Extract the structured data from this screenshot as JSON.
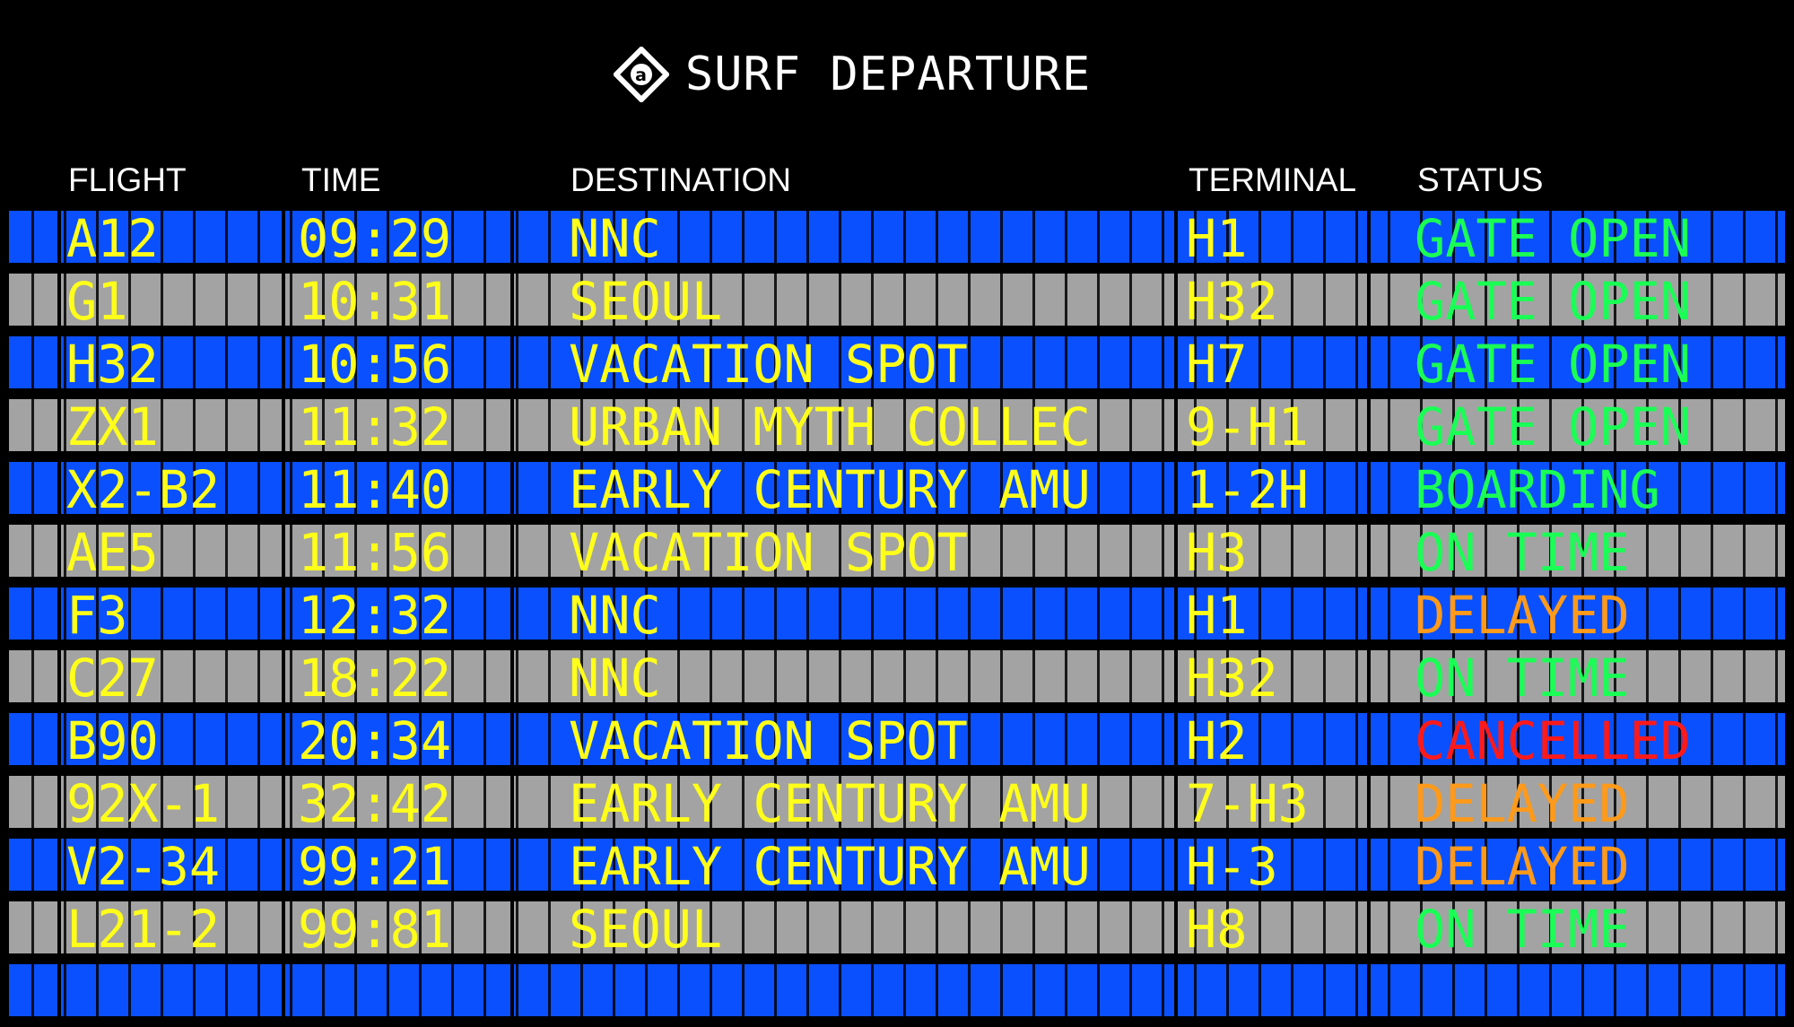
{
  "title": "SURF DEPARTURE",
  "logo_icon": "diamond-a-logo-icon",
  "headers": {
    "flight": "FLIGHT",
    "time": "TIME",
    "destination": "DESTINATION",
    "terminal": "TERMINAL",
    "status": "STATUS"
  },
  "colors": {
    "blue_row": "#0a50ff",
    "gray_row": "#a3a3a3",
    "text_yellow": "#ffff1a",
    "status_green": "#1aff55",
    "status_orange": "#ff9a1a",
    "status_red": "#ff1a1a"
  },
  "rows": [
    {
      "flight": "A12",
      "time": "09:29",
      "destination": "NNC",
      "terminal": "H1",
      "status": "GATE OPEN",
      "status_color": "#1aff55"
    },
    {
      "flight": "G1",
      "time": "10:31",
      "destination": "SEOUL",
      "terminal": "H32",
      "status": "GATE OPEN",
      "status_color": "#1aff55"
    },
    {
      "flight": "H32",
      "time": "10:56",
      "destination": "VACATION SPOT",
      "terminal": "H7",
      "status": "GATE OPEN",
      "status_color": "#1aff55"
    },
    {
      "flight": "ZX1",
      "time": "11:32",
      "destination": "URBAN MYTH COLLEC",
      "terminal": "9-H1",
      "status": "GATE OPEN",
      "status_color": "#1aff55"
    },
    {
      "flight": "X2-B2",
      "time": "11:40",
      "destination": "EARLY CENTURY AMU",
      "terminal": "1-2H",
      "status": "BOARDING",
      "status_color": "#1aff55"
    },
    {
      "flight": "AE5",
      "time": "11:56",
      "destination": "VACATION SPOT",
      "terminal": "H3",
      "status": "ON TIME",
      "status_color": "#1aff55"
    },
    {
      "flight": "F3",
      "time": "12:32",
      "destination": "NNC",
      "terminal": "H1",
      "status": "DELAYED",
      "status_color": "#ff9a1a"
    },
    {
      "flight": "C27",
      "time": "18:22",
      "destination": "NNC",
      "terminal": "H32",
      "status": "ON TIME",
      "status_color": "#1aff55"
    },
    {
      "flight": "B90",
      "time": "20:34",
      "destination": "VACATION SPOT",
      "terminal": "H2",
      "status": "CANCELLED",
      "status_color": "#ff1a1a"
    },
    {
      "flight": "92X-1",
      "time": "32:42",
      "destination": "EARLY CENTURY AMU",
      "terminal": "7-H3",
      "status": "DELAYED",
      "status_color": "#ff9a1a"
    },
    {
      "flight": "V2-34",
      "time": "99:21",
      "destination": "EARLY CENTURY AMU",
      "terminal": "H-3",
      "status": "DELAYED",
      "status_color": "#ff9a1a"
    },
    {
      "flight": "L21-2",
      "time": "99:81",
      "destination": "SEOUL",
      "terminal": "H8",
      "status": "ON TIME",
      "status_color": "#1aff55"
    },
    {
      "flight": "",
      "time": "",
      "destination": "",
      "terminal": "",
      "status": "",
      "status_color": "#1aff55"
    }
  ]
}
